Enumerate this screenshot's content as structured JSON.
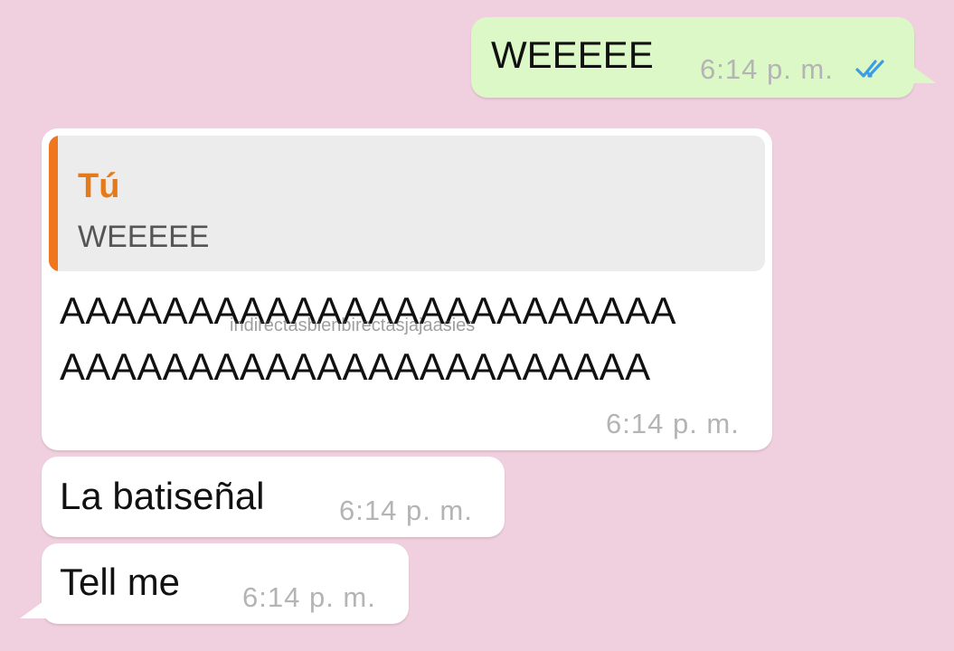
{
  "messages": [
    {
      "id": "out-1",
      "direction": "outgoing",
      "text": "WEEEEE",
      "time": "6:14 p. m.",
      "status": "read",
      "status_icon": "double-check-icon",
      "status_color": "#3c9ce5"
    },
    {
      "id": "in-reply",
      "direction": "incoming",
      "quote": {
        "author": "Tú",
        "text": "WEEEEE",
        "accent_color": "#f0761d"
      },
      "text_lines": [
        "AAAAAAAAAAAAAAAAAAAAAAAA",
        "AAAAAAAAAAAAAAAAAAAAAAA"
      ],
      "watermark": "indirectasbienbirectasjajaasies",
      "time": "6:14 p. m."
    },
    {
      "id": "in-2",
      "direction": "incoming",
      "text": "La batiseñal",
      "time": "6:14 p. m."
    },
    {
      "id": "in-3",
      "direction": "incoming",
      "text": "Tell me",
      "time": "6:14 p. m."
    }
  ],
  "colors": {
    "background": "#f0d0de",
    "outgoing_bubble": "#dcf8c6",
    "incoming_bubble": "#ffffff",
    "timestamp": "#b4b4b4"
  }
}
